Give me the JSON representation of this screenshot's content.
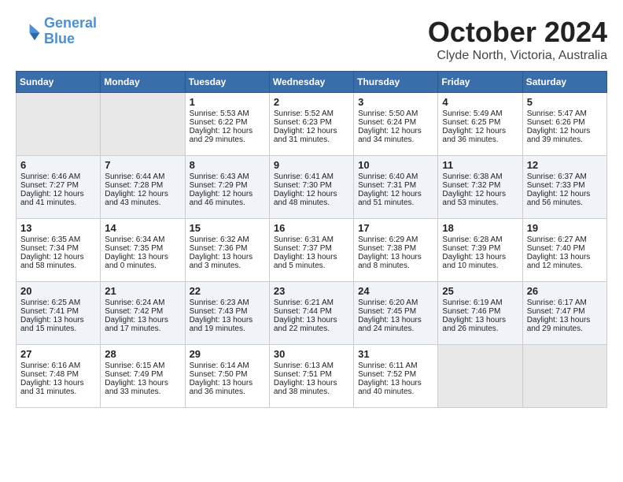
{
  "logo": {
    "line1": "General",
    "line2": "Blue"
  },
  "title": "October 2024",
  "location": "Clyde North, Victoria, Australia",
  "days_of_week": [
    "Sunday",
    "Monday",
    "Tuesday",
    "Wednesday",
    "Thursday",
    "Friday",
    "Saturday"
  ],
  "weeks": [
    [
      {
        "num": "",
        "empty": true
      },
      {
        "num": "",
        "empty": true
      },
      {
        "num": "1",
        "sunrise": "Sunrise: 5:53 AM",
        "sunset": "Sunset: 6:22 PM",
        "daylight": "Daylight: 12 hours and 29 minutes."
      },
      {
        "num": "2",
        "sunrise": "Sunrise: 5:52 AM",
        "sunset": "Sunset: 6:23 PM",
        "daylight": "Daylight: 12 hours and 31 minutes."
      },
      {
        "num": "3",
        "sunrise": "Sunrise: 5:50 AM",
        "sunset": "Sunset: 6:24 PM",
        "daylight": "Daylight: 12 hours and 34 minutes."
      },
      {
        "num": "4",
        "sunrise": "Sunrise: 5:49 AM",
        "sunset": "Sunset: 6:25 PM",
        "daylight": "Daylight: 12 hours and 36 minutes."
      },
      {
        "num": "5",
        "sunrise": "Sunrise: 5:47 AM",
        "sunset": "Sunset: 6:26 PM",
        "daylight": "Daylight: 12 hours and 39 minutes."
      }
    ],
    [
      {
        "num": "6",
        "sunrise": "Sunrise: 6:46 AM",
        "sunset": "Sunset: 7:27 PM",
        "daylight": "Daylight: 12 hours and 41 minutes."
      },
      {
        "num": "7",
        "sunrise": "Sunrise: 6:44 AM",
        "sunset": "Sunset: 7:28 PM",
        "daylight": "Daylight: 12 hours and 43 minutes."
      },
      {
        "num": "8",
        "sunrise": "Sunrise: 6:43 AM",
        "sunset": "Sunset: 7:29 PM",
        "daylight": "Daylight: 12 hours and 46 minutes."
      },
      {
        "num": "9",
        "sunrise": "Sunrise: 6:41 AM",
        "sunset": "Sunset: 7:30 PM",
        "daylight": "Daylight: 12 hours and 48 minutes."
      },
      {
        "num": "10",
        "sunrise": "Sunrise: 6:40 AM",
        "sunset": "Sunset: 7:31 PM",
        "daylight": "Daylight: 12 hours and 51 minutes."
      },
      {
        "num": "11",
        "sunrise": "Sunrise: 6:38 AM",
        "sunset": "Sunset: 7:32 PM",
        "daylight": "Daylight: 12 hours and 53 minutes."
      },
      {
        "num": "12",
        "sunrise": "Sunrise: 6:37 AM",
        "sunset": "Sunset: 7:33 PM",
        "daylight": "Daylight: 12 hours and 56 minutes."
      }
    ],
    [
      {
        "num": "13",
        "sunrise": "Sunrise: 6:35 AM",
        "sunset": "Sunset: 7:34 PM",
        "daylight": "Daylight: 12 hours and 58 minutes."
      },
      {
        "num": "14",
        "sunrise": "Sunrise: 6:34 AM",
        "sunset": "Sunset: 7:35 PM",
        "daylight": "Daylight: 13 hours and 0 minutes."
      },
      {
        "num": "15",
        "sunrise": "Sunrise: 6:32 AM",
        "sunset": "Sunset: 7:36 PM",
        "daylight": "Daylight: 13 hours and 3 minutes."
      },
      {
        "num": "16",
        "sunrise": "Sunrise: 6:31 AM",
        "sunset": "Sunset: 7:37 PM",
        "daylight": "Daylight: 13 hours and 5 minutes."
      },
      {
        "num": "17",
        "sunrise": "Sunrise: 6:29 AM",
        "sunset": "Sunset: 7:38 PM",
        "daylight": "Daylight: 13 hours and 8 minutes."
      },
      {
        "num": "18",
        "sunrise": "Sunrise: 6:28 AM",
        "sunset": "Sunset: 7:39 PM",
        "daylight": "Daylight: 13 hours and 10 minutes."
      },
      {
        "num": "19",
        "sunrise": "Sunrise: 6:27 AM",
        "sunset": "Sunset: 7:40 PM",
        "daylight": "Daylight: 13 hours and 12 minutes."
      }
    ],
    [
      {
        "num": "20",
        "sunrise": "Sunrise: 6:25 AM",
        "sunset": "Sunset: 7:41 PM",
        "daylight": "Daylight: 13 hours and 15 minutes."
      },
      {
        "num": "21",
        "sunrise": "Sunrise: 6:24 AM",
        "sunset": "Sunset: 7:42 PM",
        "daylight": "Daylight: 13 hours and 17 minutes."
      },
      {
        "num": "22",
        "sunrise": "Sunrise: 6:23 AM",
        "sunset": "Sunset: 7:43 PM",
        "daylight": "Daylight: 13 hours and 19 minutes."
      },
      {
        "num": "23",
        "sunrise": "Sunrise: 6:21 AM",
        "sunset": "Sunset: 7:44 PM",
        "daylight": "Daylight: 13 hours and 22 minutes."
      },
      {
        "num": "24",
        "sunrise": "Sunrise: 6:20 AM",
        "sunset": "Sunset: 7:45 PM",
        "daylight": "Daylight: 13 hours and 24 minutes."
      },
      {
        "num": "25",
        "sunrise": "Sunrise: 6:19 AM",
        "sunset": "Sunset: 7:46 PM",
        "daylight": "Daylight: 13 hours and 26 minutes."
      },
      {
        "num": "26",
        "sunrise": "Sunrise: 6:17 AM",
        "sunset": "Sunset: 7:47 PM",
        "daylight": "Daylight: 13 hours and 29 minutes."
      }
    ],
    [
      {
        "num": "27",
        "sunrise": "Sunrise: 6:16 AM",
        "sunset": "Sunset: 7:48 PM",
        "daylight": "Daylight: 13 hours and 31 minutes."
      },
      {
        "num": "28",
        "sunrise": "Sunrise: 6:15 AM",
        "sunset": "Sunset: 7:49 PM",
        "daylight": "Daylight: 13 hours and 33 minutes."
      },
      {
        "num": "29",
        "sunrise": "Sunrise: 6:14 AM",
        "sunset": "Sunset: 7:50 PM",
        "daylight": "Daylight: 13 hours and 36 minutes."
      },
      {
        "num": "30",
        "sunrise": "Sunrise: 6:13 AM",
        "sunset": "Sunset: 7:51 PM",
        "daylight": "Daylight: 13 hours and 38 minutes."
      },
      {
        "num": "31",
        "sunrise": "Sunrise: 6:11 AM",
        "sunset": "Sunset: 7:52 PM",
        "daylight": "Daylight: 13 hours and 40 minutes."
      },
      {
        "num": "",
        "empty": true
      },
      {
        "num": "",
        "empty": true
      }
    ]
  ]
}
